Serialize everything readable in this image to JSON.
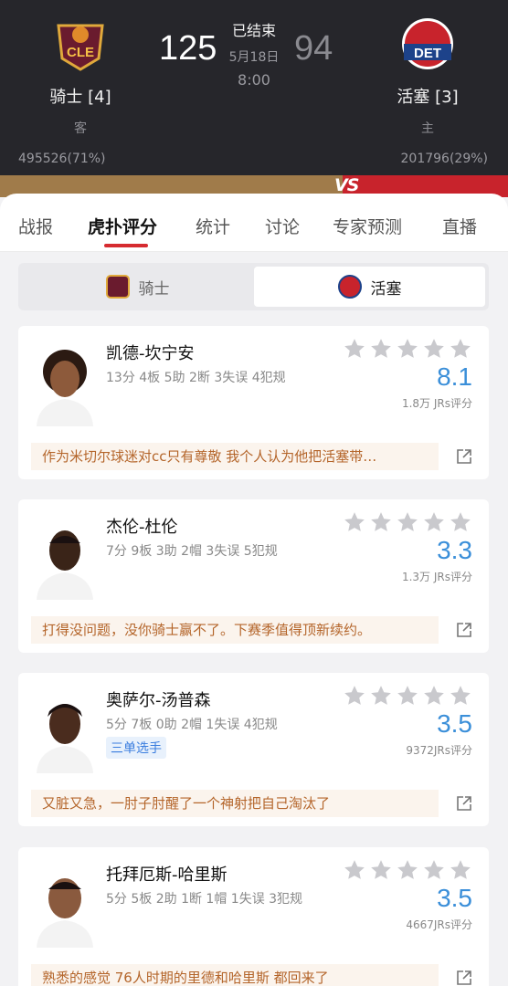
{
  "header": {
    "home": {
      "name": "骑士 [4]",
      "role": "客",
      "score": "125",
      "support": "495526(71%)",
      "logo_text": "CLE"
    },
    "away": {
      "name": "活塞 [3]",
      "role": "主",
      "score": "94",
      "support": "201796(29%)",
      "logo_text": "DET"
    },
    "status": "已结束",
    "date": "5月18日",
    "time": "8:00",
    "vs": "VS"
  },
  "colors": {
    "accent_red": "#d62b30",
    "rating_blue": "#3b8fd9",
    "comment_text": "#b4652a"
  },
  "tabs": [
    "战报",
    "虎扑评分",
    "统计",
    "讨论",
    "专家预测",
    "直播"
  ],
  "active_tab": "虎扑评分",
  "team_toggle": {
    "left": "骑士",
    "right": "活塞",
    "selected": "活塞"
  },
  "players": [
    {
      "name": "凯德-坎宁安",
      "stats": "13分 4板 5助 2断 3失误 4犯规",
      "badge": "",
      "rating": "8.1",
      "count": "1.8万 JRs评分",
      "comment": "作为米切尔球迷对cc只有尊敬 我个人认为他把活塞带…"
    },
    {
      "name": "杰伦-杜伦",
      "stats": "7分 9板 3助 2帽 3失误 5犯规",
      "badge": "",
      "rating": "3.3",
      "count": "1.3万 JRs评分",
      "comment": "打得没问题，没你骑士赢不了。下赛季值得顶新续约。"
    },
    {
      "name": "奥萨尔-汤普森",
      "stats": "5分 7板 0助 2帽 1失误 4犯规",
      "badge": "三单选手",
      "rating": "3.5",
      "count": "9372JRs评分",
      "comment": "又脏又急，一肘子肘醒了一个神射把自己淘汰了"
    },
    {
      "name": "托拜厄斯-哈里斯",
      "stats": "5分 5板 2助 1断 1帽 1失误 3犯规",
      "badge": "",
      "rating": "3.5",
      "count": "4667JRs评分",
      "comment": "熟悉的感觉 76人时期的里德和哈里斯 都回来了"
    }
  ]
}
